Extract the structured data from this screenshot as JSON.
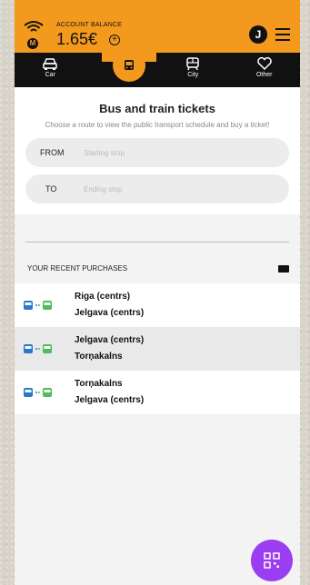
{
  "header": {
    "balance_label": "ACCOUNT BALANCE",
    "balance_value": "1.65€",
    "avatar_initial": "J"
  },
  "nav": {
    "items": [
      {
        "label": "Car",
        "icon": "car-icon"
      },
      {
        "label": "",
        "icon": "bus-icon"
      },
      {
        "label": "City",
        "icon": "city-icon"
      },
      {
        "label": "Other",
        "icon": "heart-icon"
      }
    ]
  },
  "tickets": {
    "title": "Bus and train tickets",
    "subtitle": "Choose a route to view the public transport schedule and buy a ticket!",
    "from_label": "FROM",
    "from_placeholder": "Starting stop",
    "to_label": "TO",
    "to_placeholder": "Ending stop"
  },
  "recent": {
    "header": "YOUR RECENT PURCHASES",
    "items": [
      {
        "from": "Riga (centrs)",
        "to": "Jelgava (centrs)"
      },
      {
        "from": "Jelgava (centrs)",
        "to": "Torņakalns"
      },
      {
        "from": "Torņakalns",
        "to": "Jelgava (centrs)"
      }
    ]
  },
  "colors": {
    "accent": "#f39a1e",
    "nav_bg": "#111111",
    "qr_button": "#9b3df0"
  }
}
